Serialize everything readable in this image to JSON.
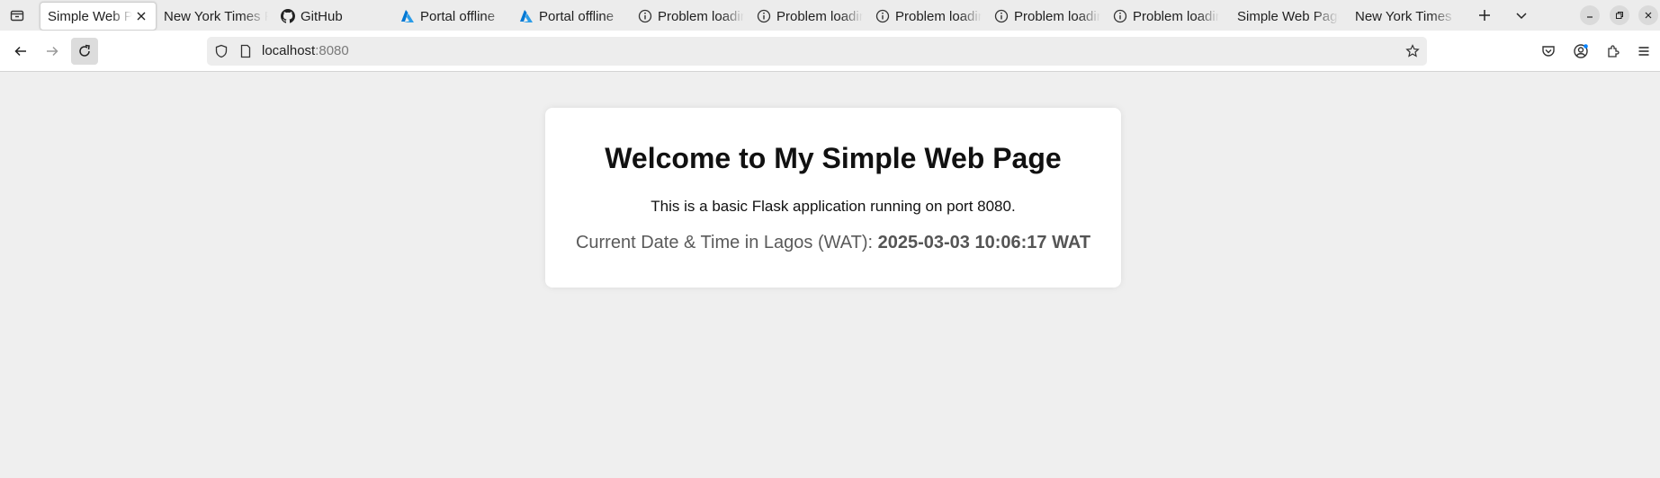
{
  "browser": {
    "tabs": [
      {
        "title": "Simple Web Page",
        "icon": "none",
        "active": true
      },
      {
        "title": "New York Times P",
        "icon": "none",
        "active": false
      },
      {
        "title": "GitHub",
        "icon": "github-icon",
        "active": false
      },
      {
        "title": "Portal offline",
        "icon": "azure-icon",
        "active": false
      },
      {
        "title": "Portal offline",
        "icon": "azure-icon",
        "active": false
      },
      {
        "title": "Problem loading",
        "icon": "info-icon",
        "active": false
      },
      {
        "title": "Problem loading",
        "icon": "info-icon",
        "active": false
      },
      {
        "title": "Problem loading",
        "icon": "info-icon",
        "active": false
      },
      {
        "title": "Problem loading",
        "icon": "info-icon",
        "active": false
      },
      {
        "title": "Problem loading",
        "icon": "info-icon",
        "active": false
      },
      {
        "title": "Simple Web Page",
        "icon": "none",
        "active": false
      },
      {
        "title": "New York Times P",
        "icon": "none",
        "active": false
      }
    ],
    "url": {
      "host": "localhost",
      "port": ":8080"
    },
    "accent_color": "#0a84ff",
    "azure_color": "#0078d4"
  },
  "page": {
    "heading": "Welcome to My Simple Web Page",
    "description": "This is a basic Flask application running on port 8080.",
    "time_label": "Current Date & Time in Lagos (WAT): ",
    "time_value": "2025-03-03 10:06:17 WAT"
  }
}
